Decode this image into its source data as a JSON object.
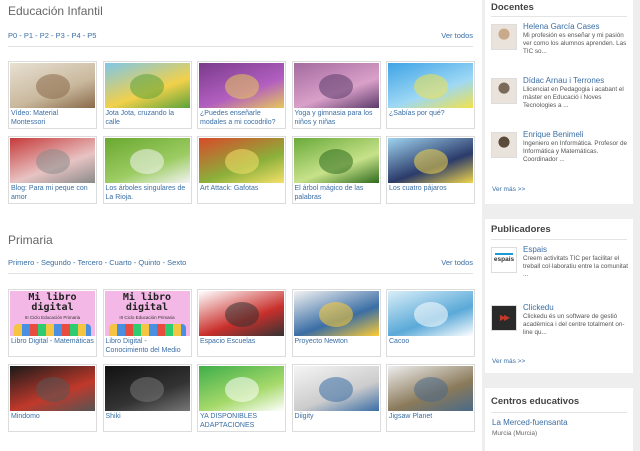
{
  "infantil": {
    "title": "Educación Infantil",
    "links": [
      "P0",
      "P1",
      "P2",
      "P3",
      "P4",
      "P5"
    ],
    "ver_todos": "Ver todos",
    "items": [
      {
        "caption": "Vídeo: Material Montessori",
        "colors": [
          "#e8e0d2",
          "#c9b89d",
          "#8a6a4a"
        ]
      },
      {
        "caption": "Jota Jota, cruzando la calle",
        "colors": [
          "#7fc7e8",
          "#f2d04a",
          "#5aa33a"
        ]
      },
      {
        "caption": "¿Puedes enseñarle modales a mi cocodrilo?",
        "colors": [
          "#7a3b8c",
          "#b25fc0",
          "#e7c85a"
        ]
      },
      {
        "caption": "Yoga y gimnasia para los niños y niñas",
        "colors": [
          "#a36b9f",
          "#d9a0c9",
          "#5b3a6a"
        ]
      },
      {
        "caption": "¿Sabías por qué?",
        "colors": [
          "#3fa3e6",
          "#9ed8f5",
          "#f0e24a"
        ]
      },
      {
        "caption": "Blog: Para mi peque con amor",
        "colors": [
          "#c63a3a",
          "#e8c3c3",
          "#8a8a8a"
        ]
      },
      {
        "caption": "Los árboles singulares de La Rioja.",
        "colors": [
          "#6aa830",
          "#9ccc63",
          "#f4f4f4"
        ]
      },
      {
        "caption": "Art Attack: Gafotas",
        "colors": [
          "#d84a2a",
          "#8bb03a",
          "#f5e06a"
        ]
      },
      {
        "caption": "El árbol mágico de las palabras",
        "colors": [
          "#6aaa3a",
          "#c7e28a",
          "#2e6b1d"
        ]
      },
      {
        "caption": "Los cuatro pájaros",
        "colors": [
          "#9fd3ef",
          "#2b3b6a",
          "#f2d64a"
        ]
      }
    ]
  },
  "primaria": {
    "title": "Primaria",
    "links": [
      "Primero",
      "Segundo",
      "Tercero",
      "Cuarto",
      "Quinto",
      "Sexto"
    ],
    "ver_todos": "Ver todos",
    "items": [
      {
        "caption": "Libro Digital - Matemáticas",
        "colors": [
          "#f3b8e6",
          "#2a2a2a",
          "#e0e0e0"
        ],
        "thumb_title": "Mi libro digital",
        "thumb_sub": "III Ciclo Educación Primaria"
      },
      {
        "caption": "Libro Digital - Conocimiento del Medio",
        "colors": [
          "#f3b8e6",
          "#2a2a2a",
          "#e0e0e0"
        ],
        "thumb_title": "Mi libro digital",
        "thumb_sub": "III Ciclo Educación Primaria"
      },
      {
        "caption": "Espacio Escuelas",
        "colors": [
          "#ffffff",
          "#c9302c",
          "#333333"
        ]
      },
      {
        "caption": "Proyecto Newton",
        "colors": [
          "#f2f2f2",
          "#3a6ea5",
          "#ffcc33"
        ]
      },
      {
        "caption": "Cacoo",
        "colors": [
          "#d9eef8",
          "#5aa9d8",
          "#ffffff"
        ]
      },
      {
        "caption": "Mindomo",
        "colors": [
          "#1a1a1a",
          "#c0392b",
          "#555555"
        ]
      },
      {
        "caption": "Shiki",
        "colors": [
          "#111111",
          "#333333",
          "#777777"
        ]
      },
      {
        "caption": "YA DISPONIBLES ADAPTACIONES",
        "colors": [
          "#3fae4a",
          "#a6d96a",
          "#ffffff"
        ]
      },
      {
        "caption": "Diigity",
        "colors": [
          "#f5f5f5",
          "#cccccc",
          "#3a6ea5"
        ]
      },
      {
        "caption": "Jigsaw Planet",
        "colors": [
          "#eeeeee",
          "#8a7a5a",
          "#4a6a8a"
        ]
      }
    ]
  },
  "sidebar": {
    "docentes": {
      "title": "Docentes",
      "people": [
        {
          "name": "Helena García Cases",
          "desc": "Mi profesión es enseñar y mi pasión ver como los alumnos aprenden. Las TIC so...",
          "avatar_color": "#c9a98a"
        },
        {
          "name": "Dídac Arnau i Terrones",
          "desc": "Llicenciat en Pedagogia i acabant el màster en Educació i Noves Tecnologies a ...",
          "avatar_color": "#7a6a5a"
        },
        {
          "name": "Enrique Benimeli",
          "desc": "Ingeniero en Informática. Profesor de Informática y Matemáticas. Coordinador ...",
          "avatar_color": "#5a4a3a"
        }
      ],
      "ver_mas": "Ver más >>"
    },
    "publicadores": {
      "title": "Publicadores",
      "items": [
        {
          "name": "Espais",
          "logo": "espais",
          "desc": "Creem activitats TIC per facilitar el treball col·laboratiu entre la comunitat ...",
          "logo_color": "#1a9bd7"
        },
        {
          "name": "Clickedu",
          "logo": "",
          "desc": "Clickedu és un software de gestió acadèmica i del centre totalment on-line qu...",
          "logo_color": "#c0392b"
        }
      ],
      "ver_mas": "Ver más >>"
    },
    "centros": {
      "title": "Centros educativos",
      "name": "La Merced-fuensanta",
      "location": "Murcia (Murcia)"
    }
  }
}
